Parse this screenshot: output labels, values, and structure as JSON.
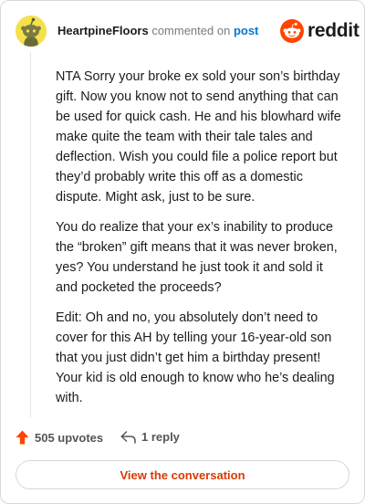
{
  "comment": {
    "username": "HeartpineFloors",
    "commented_text": "commented on",
    "post_link_text": "post",
    "paragraphs": [
      "NTA Sorry your broke ex sold your son’s birthday gift. Now you know not to send anything that can be used for quick cash. He and his blowhard wife make quite the team with their tale tales and deflection. Wish you could file a police report but they’d probably write this off as a domestic dispute. Might ask, just to be sure.",
      "You do realize that your ex’s inability to produce the “broken” gift means that it was never broken, yes? You understand he just took it and sold it and pocketed the proceeds?",
      "Edit: Oh and no, you absolutely don’t need to cover for this AH by telling your 16-year-old son that you just didn’t get him a birthday present! Your kid is old enough to know who he’s dealing with."
    ]
  },
  "brand": {
    "wordmark": "reddit",
    "color": "#ff4500"
  },
  "actions": {
    "upvotes_label": "505 upvotes",
    "reply_label": "1 reply"
  },
  "view_button": {
    "label": "View the conversation"
  },
  "icons": {
    "avatar": "snoo-avatar-icon",
    "logo": "reddit-snoo-icon",
    "upvote": "upvote-arrow-icon",
    "reply": "reply-arrow-icon"
  },
  "colors": {
    "accent": "#ff4500",
    "link": "#0079d3",
    "button_text": "#d93a00",
    "avatar_bg": "#f4e14b"
  }
}
